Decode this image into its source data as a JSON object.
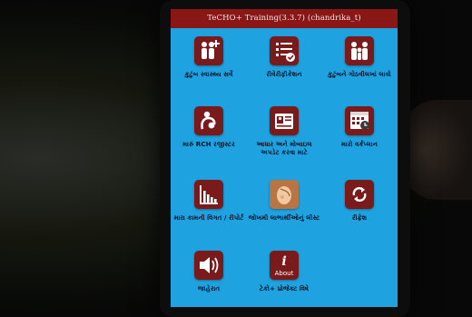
{
  "app": {
    "title": "TeCHO+ Training(3.3.7) (chandrika_t)"
  },
  "tiles": [
    {
      "label": "કુટુંબ સ્વાસ્થ્ય સર્વે",
      "icon": "family-add-icon"
    },
    {
      "label": "રીવેરીફીકેશન",
      "icon": "checklist-verify-icon"
    },
    {
      "label": "કુટુંબને ગોઠવીલખાં લાવો",
      "icon": "family-group-icon"
    },
    {
      "label": "મારું RCH રજીસ્ટર",
      "icon": "mother-child-icon"
    },
    {
      "label": "આધાર અને મોબાઇલ અપડેટ કરવા માટે",
      "icon": "id-card-icon"
    },
    {
      "label": "મારો વર્કપ્લાન",
      "icon": "schedule-calendar-icon"
    },
    {
      "label": "મારા કામની વિગત / રીપોર્ટ",
      "icon": "bar-chart-icon"
    },
    {
      "label": "જોખમી લાભાર્થીઓનું લીસ્ટ",
      "icon": "pregnant-woman-icon"
    },
    {
      "label": "રીફ્રેશ",
      "icon": "refresh-icon"
    },
    {
      "label": "જાહેરાત",
      "icon": "speaker-icon"
    },
    {
      "label": "ટેકો+ પ્રોજેક્ટ વિષે",
      "icon": "about-info-icon",
      "icon_text": "About"
    }
  ],
  "colors": {
    "screen_bg": "#1fa2e0",
    "titlebar_bg": "#8a1616",
    "icon_bg": "#7a1a1a"
  }
}
